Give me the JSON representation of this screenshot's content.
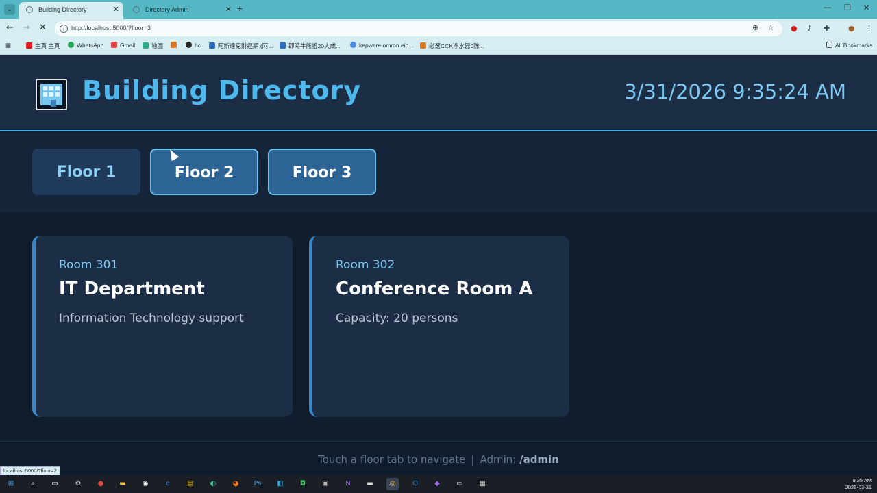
{
  "browser": {
    "tabs": [
      {
        "title": "Building Directory",
        "active": true
      },
      {
        "title": "Directory Admin",
        "active": false
      }
    ],
    "url": "http://localhost:5000/?floor=3",
    "bookmarks": [
      "主頁 主頁",
      "WhatsApp",
      "Gmail",
      "地圖",
      "hc",
      "阿斯達克財經網 (阿...",
      "即時牛熊證20大成...",
      "kepware omron eip...",
      "必選CCK净水器0陈..."
    ],
    "all_bookmarks_label": "All Bookmarks",
    "status_url": "localhost:5000/?floor=2"
  },
  "header": {
    "title": "Building Directory",
    "datetime": "3/31/2026 9:35:24 AM"
  },
  "floors": [
    {
      "label": "Floor 1",
      "highlighted": false
    },
    {
      "label": "Floor 2",
      "highlighted": true
    },
    {
      "label": "Floor 3",
      "highlighted": true
    }
  ],
  "rooms": [
    {
      "room": "Room 301",
      "name": "IT Department",
      "description": "Information Technology support"
    },
    {
      "room": "Room 302",
      "name": "Conference Room A",
      "description": "Capacity: 20 persons"
    }
  ],
  "footer": {
    "hint": "Touch a floor tab to navigate",
    "separator": "|",
    "admin_label": "Admin:",
    "admin_path": "/admin"
  },
  "taskbar": {
    "time": "9:35 AM",
    "date": "2026-03-31"
  },
  "colors": {
    "accent": "#4fb8ec",
    "header_bg": "#1b2e45",
    "page_bg": "#0f1d2c",
    "card_border": "#3a86c6"
  }
}
